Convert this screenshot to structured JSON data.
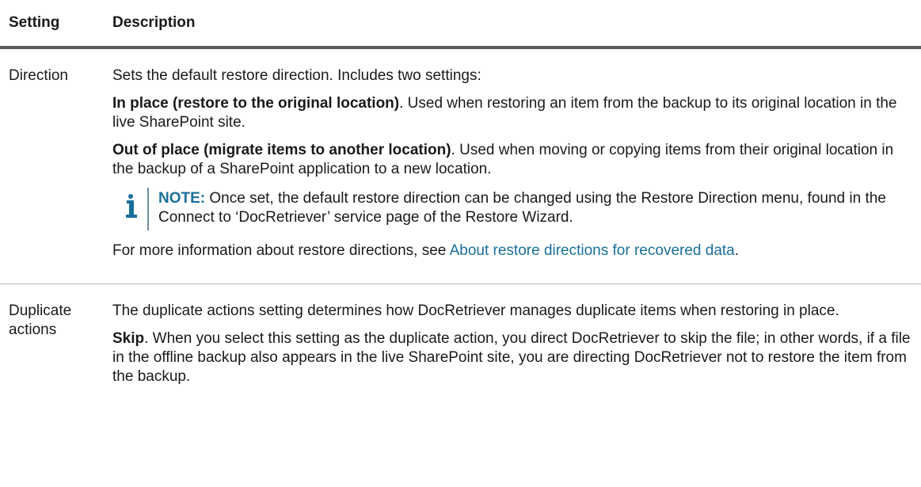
{
  "table": {
    "headers": [
      "Setting",
      "Description"
    ],
    "rows": [
      {
        "setting": "Direction",
        "intro": "Sets the default restore direction. Includes two settings:",
        "option1_title": "In place (restore to the original location)",
        "option1_text": ". Used when restoring an item from the backup to its original location in the live SharePoint site.",
        "option2_title": "Out of place (migrate items to another location)",
        "option2_text": ". Used when moving or copying items from their original location in the backup of a SharePoint application to a new location.",
        "note_label": "NOTE:",
        "note_text": " Once set, the default restore direction can be changed using the Restore Direction menu, found in the Connect to ‘DocRetriever’ service page of the Restore Wizard.",
        "more_prefix": "For more information about restore directions, see ",
        "more_link": "About restore directions for recovered data",
        "more_suffix": "."
      },
      {
        "setting": "Duplicate actions",
        "intro": "The duplicate actions setting determines how DocRetriever manages duplicate items when restoring in place.",
        "option1_title": "Skip",
        "option1_text": ". When you select this setting as the duplicate action, you direct DocRetriever to skip the file; in other words, if a file in the offline backup also appears in the live SharePoint site, you are directing DocRetriever not to restore the item from the backup."
      }
    ]
  },
  "icons": {
    "note": "info-icon"
  },
  "colors": {
    "link": "#1a6f9a",
    "note_label": "#1a6f9a",
    "header_rule": "#5a5a5a",
    "row_rule": "#b8b8b8"
  }
}
